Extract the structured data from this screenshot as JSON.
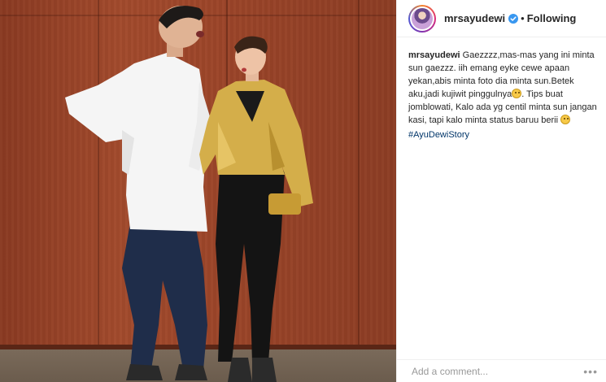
{
  "header": {
    "username": "mrsayudewi",
    "separator": "•",
    "follow_status": "Following"
  },
  "caption": {
    "username": "mrsayudewi",
    "text_1": "Gaezzzz,mas-mas yang ini minta sun gaezzz. iih emang eyke cewe apaan yekan,abis minta foto dia minta sun.Betek aku,jadi kujiwit pinggulnya",
    "text_2": ". Tips buat jomblowati, Kalo ada yg centil minta sun jangan kasi, tapi kalo minta status baruu berii",
    "hashtag": "#AyuDewiStory"
  },
  "comment": {
    "placeholder": "Add a comment...",
    "more_icon": "•••"
  },
  "icons": {
    "verified": "verified-badge-icon",
    "emoji": "smiling-face-emoji-icon",
    "more": "more-options-icon"
  },
  "colors": {
    "verified_blue": "#3897f0",
    "hashtag_blue": "#003569",
    "text": "#262626",
    "placeholder": "#999999"
  }
}
